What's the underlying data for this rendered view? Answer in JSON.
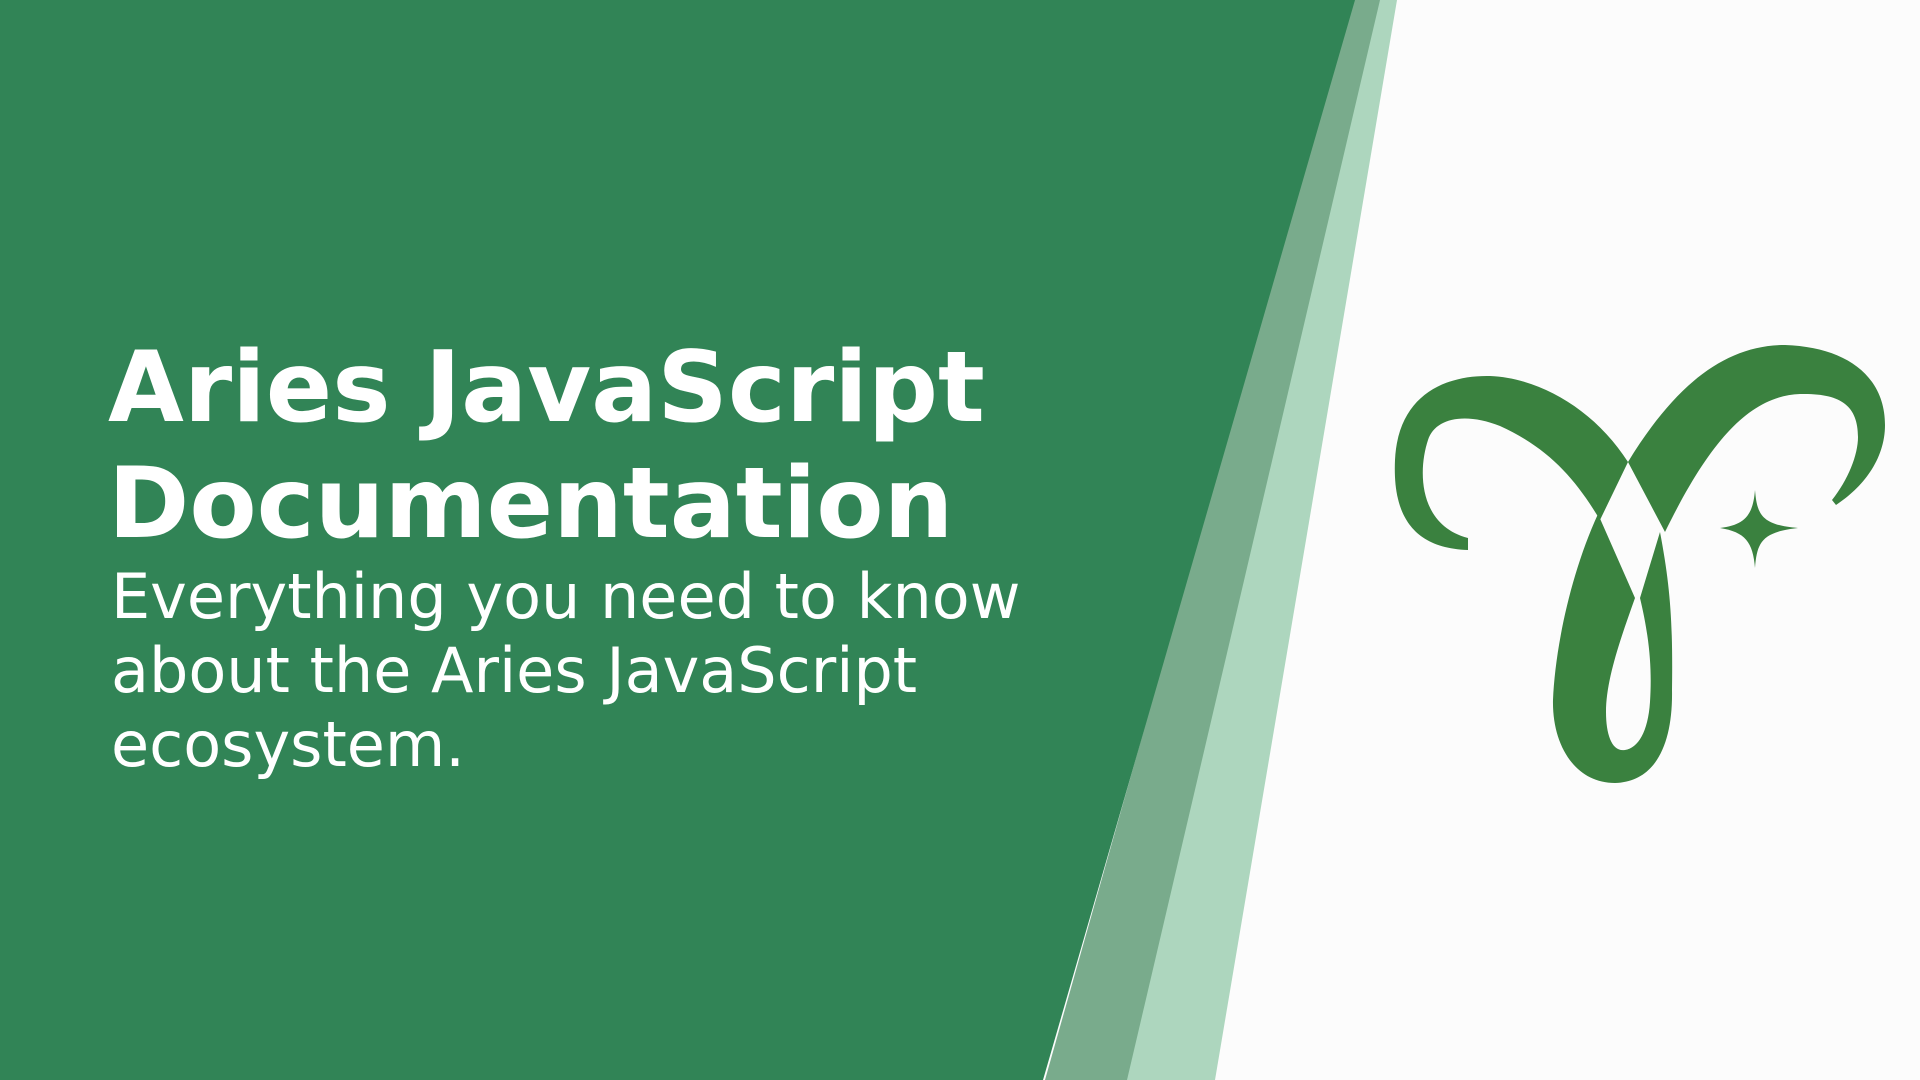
{
  "hero": {
    "title": "Aries JavaScript Documentation",
    "subtitle": "Everything you need to know about the Aries JavaScript ecosystem."
  },
  "logo": {
    "icon": "aries-ram-icon",
    "color": "#3a813f"
  },
  "colors": {
    "panel": "#318456",
    "stripe_dark": "#79ab8c",
    "stripe_light": "#add6be",
    "background": "#fcfcfc",
    "text": "#ffffff"
  }
}
